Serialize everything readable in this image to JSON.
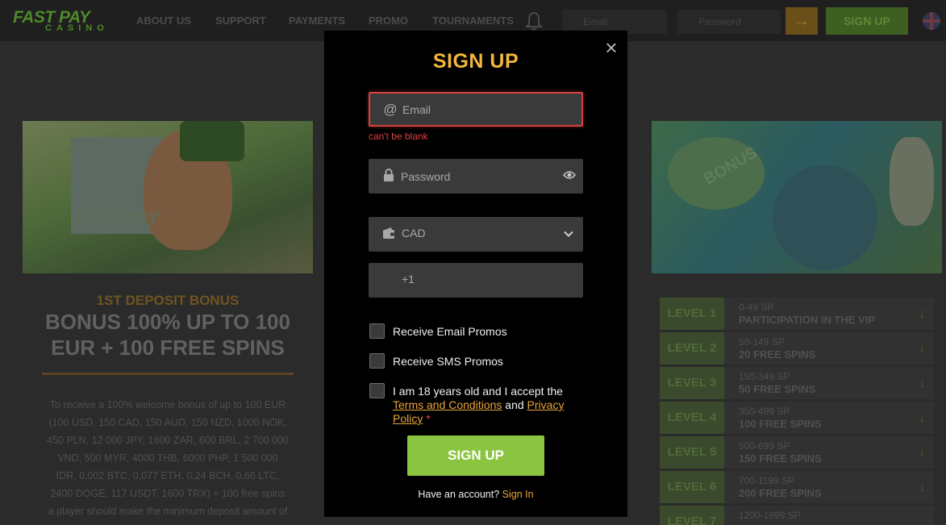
{
  "header": {
    "logo_top": "FAST PAY",
    "logo_bottom": "CASINO",
    "nav": [
      "ABOUT US",
      "SUPPORT",
      "PAYMENTS",
      "PROMO",
      "TOURNAMENTS"
    ],
    "email_placeholder": "Email",
    "password_placeholder": "Password",
    "arrow": "→",
    "signup_label": "SIGN UP"
  },
  "promo": {
    "logo_top": "FAST PAY",
    "logo_bottom": "CASINO",
    "deposit_label": "1ST DEPOSIT BONUS",
    "headline_1": "BONUS 100% UP TO 100",
    "headline_2": "EUR + 100 FREE SPINS",
    "body_lines": [
      "To receive a 100% welcome bonus of up to 100 EUR",
      "(100 USD, 150 CAD, 150 AUD, 150 NZD, 1000 NOK,",
      "450 PLN, 12 000 JPY, 1600 ZAR, 600 BRL, 2 700 000",
      "VND, 500 MYR, 4000 THB, 6000 PHP, 1 500 000",
      "IDR, 0,002 BTC, 0,077 ETH, 0,24 BCH, 0,66 LTC,",
      "2400 DOGE, 117 USDT, 1600 TRX) + 100 free spins",
      "a player should make the minimum deposit amount of"
    ]
  },
  "vip_banner": {
    "text": "BONUS"
  },
  "levels": [
    {
      "label": "LEVEL 1",
      "sp": "0-49 SP",
      "reward": "PARTICIPATION IN THE VIP"
    },
    {
      "label": "LEVEL 2",
      "sp": "50-149 SP",
      "reward": "20 FREE SPINS"
    },
    {
      "label": "LEVEL 3",
      "sp": "150-349 SP",
      "reward": "50 FREE SPINS"
    },
    {
      "label": "LEVEL 4",
      "sp": "350-499 SP",
      "reward": "100 FREE SPINS"
    },
    {
      "label": "LEVEL 5",
      "sp": "500-699 SP",
      "reward": "150 FREE SPINS"
    },
    {
      "label": "LEVEL 6",
      "sp": "700-1199 SP",
      "reward": "200 FREE SPINS"
    },
    {
      "label": "LEVEL 7",
      "sp": "1200-1999 SP",
      "reward": ""
    }
  ],
  "modal": {
    "close": "×",
    "title": "SIGN UP",
    "email_placeholder": "Email",
    "email_error": "can't be blank",
    "password_placeholder": "Password",
    "currency_value": "CAD",
    "phone_prefix": "+1",
    "email_promos": "Receive Email Promos",
    "sms_promos": "Receive SMS Promos",
    "terms_prefix": "I am 18 years old and I accept the",
    "terms_link": "Terms and Conditions",
    "terms_and": "and",
    "privacy_link_1": "Privacy",
    "privacy_link_2": "Policy",
    "asterisk": "*",
    "submit": "SIGN UP",
    "have_account": "Have an account?",
    "sign_in": "Sign In"
  }
}
